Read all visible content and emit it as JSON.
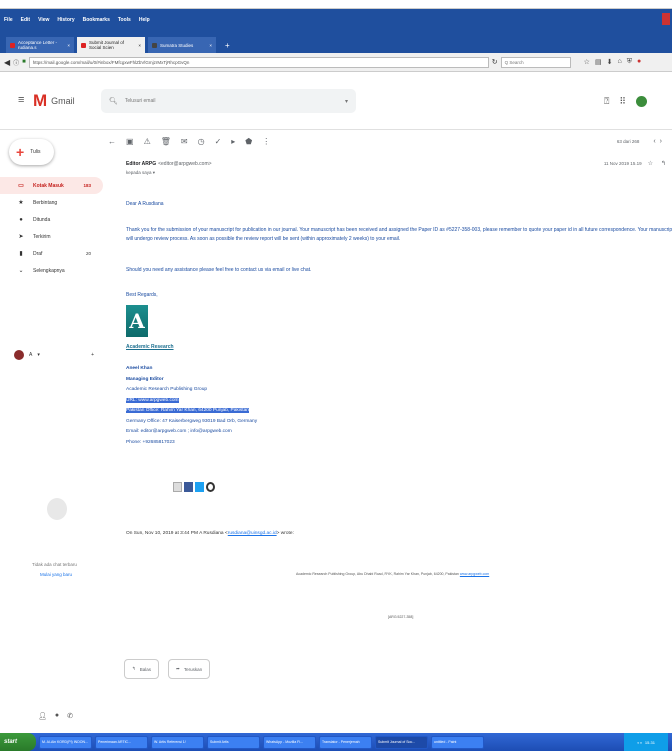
{
  "browser": {
    "menu": [
      "File",
      "Edit",
      "View",
      "History",
      "Bookmarks",
      "Tools",
      "Help"
    ],
    "tabs": [
      {
        "label": "Acceptance Letter - rudiana.s",
        "active": false
      },
      {
        "label": "Submit Journal of Social Scien",
        "active": true
      },
      {
        "label": "Sumatra Studies",
        "active": false
      }
    ],
    "url": "https://mail.google.com/mail/u/0/#inbox/FMfcgxwFhlZbVlGmjzrMxTjRhcpGvQn",
    "search_placeholder": "Q Search"
  },
  "gmail": {
    "logo_text": "Gmail",
    "search_placeholder": "Telusuri email",
    "compose_label": "Tulis",
    "nav": [
      {
        "label": "Kotak Masuk",
        "count": "183",
        "icon": "inbox-icon",
        "active": true
      },
      {
        "label": "Berbintang",
        "count": "",
        "icon": "star-icon",
        "active": false
      },
      {
        "label": "Ditunda",
        "count": "",
        "icon": "clock-icon",
        "active": false
      },
      {
        "label": "Terkirim",
        "count": "",
        "icon": "send-icon",
        "active": false
      },
      {
        "label": "Draf",
        "count": "20",
        "icon": "draft-icon",
        "active": false
      },
      {
        "label": "Selengkapnya",
        "count": "",
        "icon": "chevron-down-icon",
        "active": false
      }
    ],
    "hangout_user": "A",
    "chat_empty_line1": "Tidak ada chat terbaru",
    "chat_empty_line2": "Mulai yang baru",
    "pager": "63 dari 268"
  },
  "message": {
    "sender_name": "Editor ARPG",
    "sender_email": "<editor@arpgweb.com>",
    "date": "11 Nov 2019 15.19",
    "to": "kepada saya",
    "greeting": "Dear A Rusdiana",
    "paragraph1": "Thank you for the submission of your manuscript for publication in our journal. Your manuscript has been received and assigned the Paper ID as #5227-358-003, please remember to quote your paper id in all future correspondence. Your manuscript will undergo review process. As soon as possible the review report will be sent (within approximately 2 weeks) to your email.",
    "paragraph2": "Should you need any assistance please feel free to contact us via email or live chat.",
    "closing": "Best Regards,",
    "logo_name": "Academic Research",
    "sig_name": "Aneel Khan",
    "sig_title": "Managing Editor",
    "sig_org": "Academic Research Publishing Group",
    "sig_url": "URL: www.arpgweb.com",
    "sig_pakistan": "Pakistan Office: Rahim Yar Khan, 64200 Punjab, Pakistan",
    "sig_germany": "Germany Office: 47 Kaiserbergweg 93019 Bad Orb, Germany",
    "sig_email": "Email: editor@arpgweb.com ; info@arpgweb.com",
    "sig_phone": "Phone: +92685817023",
    "on_wrote_prefix": "On Sun, Nov 10, 2019 at 3:44 PM A Rusdiana <",
    "on_wrote_email": "rusdiana@uinsgd.ac.id",
    "on_wrote_suffix": "> wrote:",
    "footer_text": "Academic Research Publishing Group, Abu Dhabi Road, RYK, Rahim Yar Khan, Punjab, 64200, Pakistan",
    "footer_link": "www.arpgweb.com",
    "ref_code": "[ARG:5227-358]",
    "reply_label": "Balas",
    "forward_label": "Teruskan"
  },
  "taskbar": {
    "start_label": "start",
    "items": [
      "M. Al-Ain KORD(PI) INDON...",
      "Penerimaan ARTIC...",
      "W. Artis Referensi 1/",
      "Submit Artis",
      "WhatsApp - Mozilla Fi...",
      "Translator - Penerjemah",
      "Submit Journal of Soc...",
      "untitled - Paint"
    ],
    "tray_time": "15.31"
  }
}
